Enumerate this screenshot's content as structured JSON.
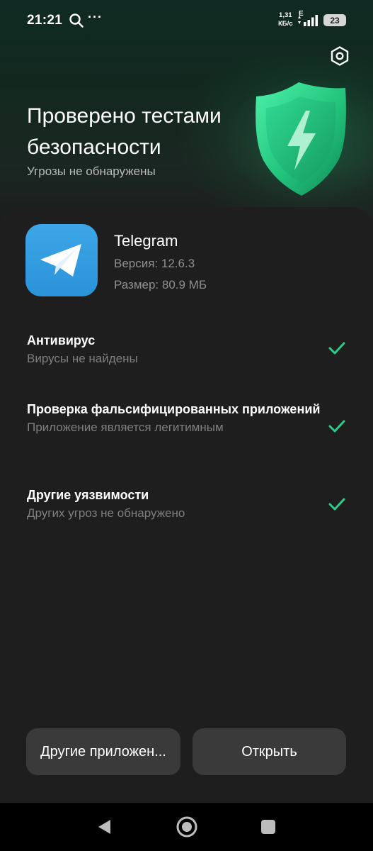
{
  "status_bar": {
    "time": "21:21",
    "more": "···",
    "net_speed_value": "1,31",
    "net_speed_unit": "КБ/с",
    "net_type": "E",
    "battery": "23"
  },
  "header": {
    "title": "Проверено тестами безопасности",
    "subtitle": "Угрозы не обнаружены"
  },
  "app": {
    "name": "Telegram",
    "version": "Версия: 12.6.3",
    "size": "Размер: 80.9 МБ"
  },
  "checks": [
    {
      "title": "Антивирус",
      "subtitle": "Вирусы не найдены",
      "passed": true
    },
    {
      "title": "Проверка фальсифицированных приложений",
      "subtitle": "Приложение является легитимным",
      "passed": true
    },
    {
      "title": "Другие уязвимости",
      "subtitle": "Других угроз не обнаружено",
      "passed": true
    }
  ],
  "buttons": {
    "other_apps": "Другие приложен...",
    "open": "Открыть"
  },
  "icons": {
    "search": "search-icon",
    "settings": "settings-hex-icon",
    "shield": "shield-lightning-icon",
    "app": "telegram-icon",
    "check": "checkmark-icon"
  },
  "colors": {
    "accent_green": "#2ecc8a",
    "telegram_blue": "#2f9be0",
    "background": "#1e1e1e"
  }
}
